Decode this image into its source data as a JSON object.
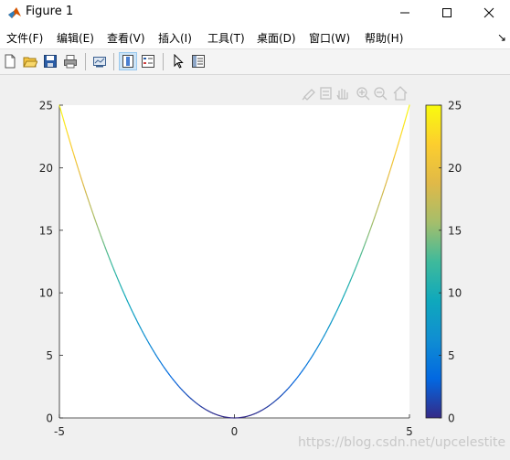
{
  "window": {
    "title": "Figure 1",
    "controls": [
      "minimize",
      "maximize",
      "close"
    ]
  },
  "menu": {
    "items": [
      {
        "label": "文件(F)"
      },
      {
        "label": "编辑(E)"
      },
      {
        "label": "查看(V)"
      },
      {
        "label": "插入(I)"
      },
      {
        "label": "工具(T)"
      },
      {
        "label": "桌面(D)"
      },
      {
        "label": "窗口(W)"
      },
      {
        "label": "帮助(H)"
      }
    ],
    "overflow_icon": "arrow-icon"
  },
  "toolbar": {
    "buttons": [
      {
        "icon": "new-figure-icon"
      },
      {
        "icon": "open-file-icon"
      },
      {
        "icon": "save-icon"
      },
      {
        "icon": "print-icon"
      },
      {
        "icon": "link-plot-icon"
      },
      {
        "icon": "insert-colorbar-icon",
        "active": true
      },
      {
        "icon": "insert-legend-icon"
      },
      {
        "icon": "edit-plot-icon"
      },
      {
        "icon": "property-inspector-icon"
      }
    ]
  },
  "axes_toolbar": {
    "icons": [
      "brush-icon",
      "datatip-icon",
      "pan-icon",
      "zoom-in-icon",
      "zoom-out-icon",
      "home-icon"
    ]
  },
  "chart_data": {
    "type": "line",
    "function": "y = x^2, colored by y value",
    "x": [
      -5,
      -4.5,
      -4,
      -3.5,
      -3,
      -2.5,
      -2,
      -1.5,
      -1,
      -0.5,
      0,
      0.5,
      1,
      1.5,
      2,
      2.5,
      3,
      3.5,
      4,
      4.5,
      5
    ],
    "y": [
      25,
      20.25,
      16,
      12.25,
      9,
      6.25,
      4,
      2.25,
      1,
      0.25,
      0,
      0.25,
      1,
      2.25,
      4,
      6.25,
      9,
      12.25,
      16,
      20.25,
      25
    ],
    "xlim": [
      -5,
      5
    ],
    "ylim": [
      0,
      25
    ],
    "xticks": [
      "-5",
      "0",
      "5"
    ],
    "yticks": [
      "0",
      "5",
      "10",
      "15",
      "20",
      "25"
    ],
    "grid": false,
    "colorbar": {
      "colormap": "parula",
      "limits": [
        0,
        25
      ],
      "ticks": [
        "0",
        "5",
        "10",
        "15",
        "20",
        "25"
      ],
      "location": "right"
    },
    "colormap_stops": [
      "#352a87",
      "#0268e1",
      "#108ed2",
      "#0fa8bc",
      "#3fba9b",
      "#a5be6b",
      "#e0b948",
      "#fcce2e",
      "#f9fb0e"
    ]
  },
  "watermark": "https://blog.csdn.net/upcelestite"
}
